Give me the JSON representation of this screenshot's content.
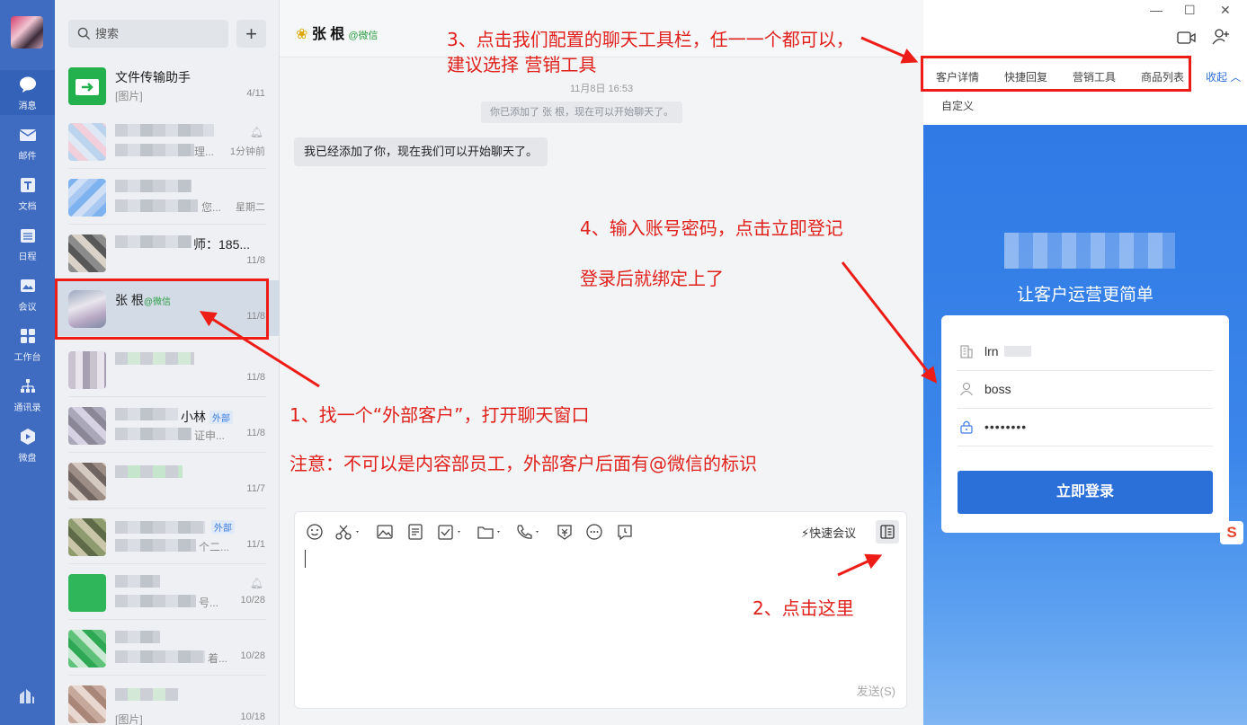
{
  "nav": {
    "items": [
      {
        "label": "消息",
        "icon": "chat-bubble-icon"
      },
      {
        "label": "邮件",
        "icon": "mail-icon"
      },
      {
        "label": "文档",
        "icon": "document-icon"
      },
      {
        "label": "日程",
        "icon": "calendar-icon"
      },
      {
        "label": "会议",
        "icon": "meeting-icon"
      },
      {
        "label": "工作台",
        "icon": "workbench-icon"
      },
      {
        "label": "通讯录",
        "icon": "contacts-icon"
      },
      {
        "label": "微盘",
        "icon": "drive-icon"
      }
    ]
  },
  "search": {
    "placeholder": "搜索"
  },
  "conversations": [
    {
      "name": "文件传输助手",
      "preview": "[图片]",
      "time": "4/11"
    },
    {
      "name": "",
      "preview": "理...",
      "time": "1分钟前"
    },
    {
      "name": "",
      "preview": "您...",
      "time": "星期二"
    },
    {
      "name": "师：185...",
      "preview": "",
      "time": "11/8"
    },
    {
      "name": "张  根",
      "suffix": "@微信",
      "preview": "",
      "time": "11/8"
    },
    {
      "name": "",
      "preview": "",
      "time": "11/8"
    },
    {
      "name": "小林",
      "tag": "外部",
      "preview": "证申...",
      "time": "11/8"
    },
    {
      "name": "",
      "preview": "",
      "time": "11/7"
    },
    {
      "name": "",
      "tag": "外部",
      "preview": "个二...",
      "time": "11/1"
    },
    {
      "name": "",
      "preview": "号...",
      "time": "10/28"
    },
    {
      "name": "",
      "preview": "着...",
      "time": "10/28"
    },
    {
      "name": "",
      "preview": "[图片]",
      "time": "10/18"
    }
  ],
  "chat": {
    "title": "张  根",
    "title_suffix": "@微信",
    "time": "11月8日 16:53",
    "system_msg": "你已添加了  张  根，现在可以开始聊天了。",
    "message": "我已经添加了你，现在我们可以开始聊天了。",
    "quick_meeting": "快速会议",
    "send": "发送(S)"
  },
  "right": {
    "tabs": [
      "客户详情",
      "快捷回复",
      "营销工具",
      "商品列表"
    ],
    "collapse": "收起",
    "custom": "自定义",
    "slogan": "让客户运营更简单",
    "org_value": "lrn",
    "username": "boss",
    "password": "••••••••",
    "login": "立即登录"
  },
  "annotations": {
    "step1": "1、找一个“外部客户”，打开聊天窗口",
    "note": "注意：不可以是内容部员工，外部客户后面有@微信的标识",
    "step2": "2、点击这里",
    "step3a": "3、点击我们配置的聊天工具栏，任一一个都可以，",
    "step3b": "建议选择    营销工具",
    "step4": "4、输入账号密码，点击立即登记",
    "step4b": "登录后就绑定上了"
  },
  "colors": {
    "nav_bg": "#3f6cc0",
    "accent": "#2b6fd9",
    "annotation": "#e0201b"
  }
}
